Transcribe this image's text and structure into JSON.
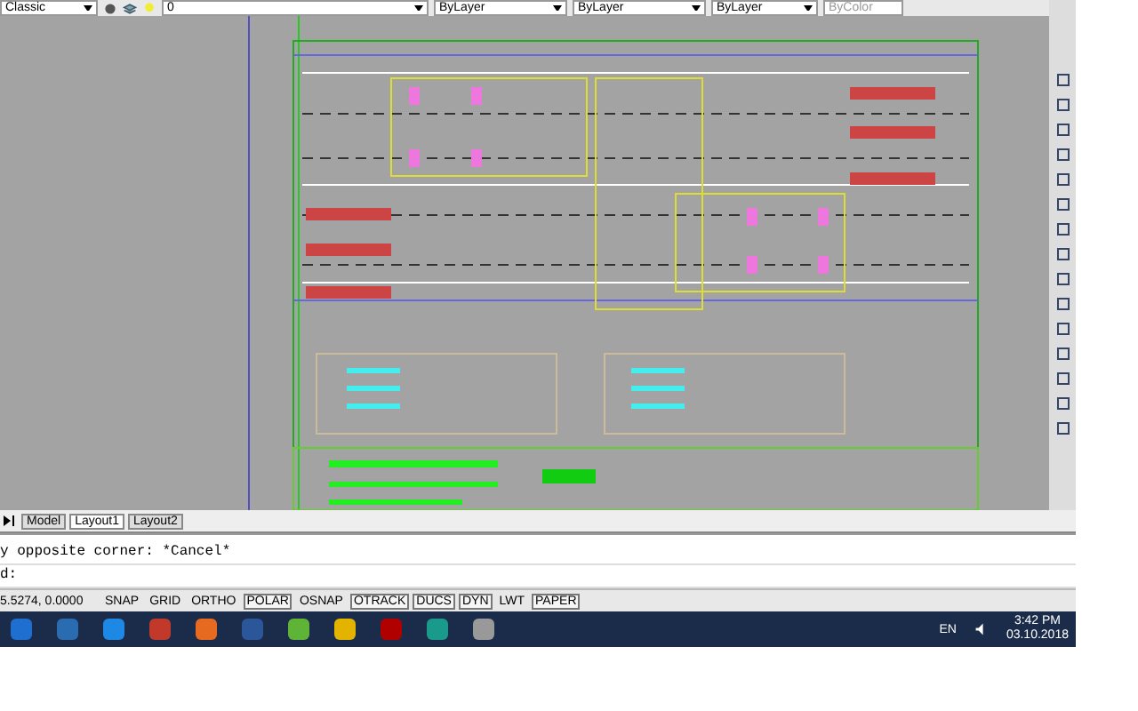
{
  "toolbar": {
    "workspace": "Classic",
    "layer": "0",
    "color_control": "ByLayer",
    "linetype": "ByLayer",
    "lineweight": "ByLayer",
    "plotstyle": "ByColor"
  },
  "layout_tabs": [
    {
      "label": "Model",
      "selected": false
    },
    {
      "label": "Layout1",
      "selected": true
    },
    {
      "label": "Layout2",
      "selected": false
    }
  ],
  "command_lines": [
    "y opposite corner: *Cancel*",
    "d:"
  ],
  "status_bar": {
    "coordinates": "5.5274, 0.0000",
    "toggles": [
      {
        "label": "SNAP",
        "on": false
      },
      {
        "label": "GRID",
        "on": false
      },
      {
        "label": "ORTHO",
        "on": false
      },
      {
        "label": "POLAR",
        "on": true
      },
      {
        "label": "OSNAP",
        "on": false
      },
      {
        "label": "OTRACK",
        "on": true
      },
      {
        "label": "DUCS",
        "on": true
      },
      {
        "label": "DYN",
        "on": true
      },
      {
        "label": "LWT",
        "on": false
      },
      {
        "label": "PAPER",
        "on": true
      }
    ]
  },
  "taskbar": {
    "language": "EN",
    "time": "3:42 PM",
    "date": "03.10.2018"
  }
}
